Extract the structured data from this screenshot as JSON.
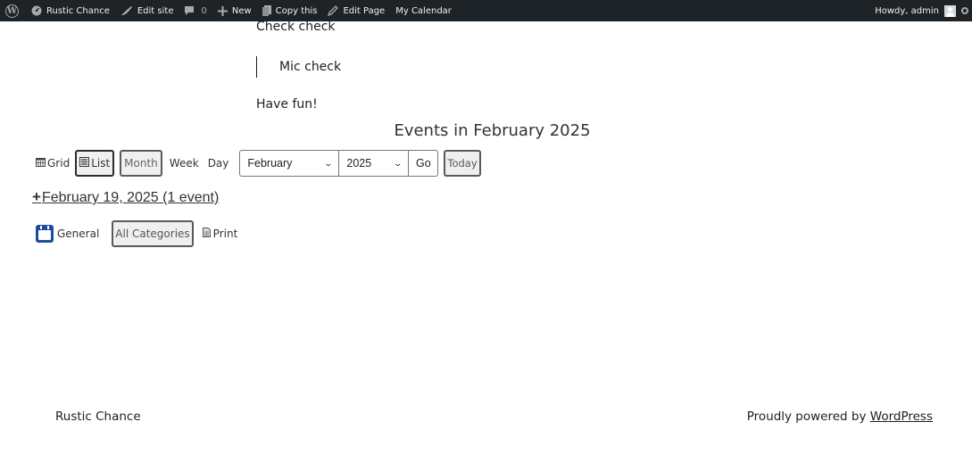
{
  "adminbar": {
    "items": [
      {
        "name": "wp-logo",
        "icon": "wordpress-icon",
        "label": ""
      },
      {
        "name": "site-name",
        "icon": "dashboard-icon",
        "label": "Rustic Chance"
      },
      {
        "name": "edit-site",
        "icon": "brush-icon",
        "label": "Edit site"
      },
      {
        "name": "comments",
        "icon": "comment-icon",
        "label": "0"
      },
      {
        "name": "new",
        "icon": "plus-icon",
        "label": "New"
      },
      {
        "name": "copy-this",
        "icon": "copy-icon",
        "label": "Copy this"
      },
      {
        "name": "edit-page",
        "icon": "pencil-icon",
        "label": "Edit Page"
      },
      {
        "name": "my-calendar",
        "icon": "",
        "label": "My Calendar"
      }
    ],
    "greeting": "Howdy, admin"
  },
  "content": {
    "paragraph1": "Check check",
    "quote": "Mic check",
    "paragraph2": "Have fun!"
  },
  "calendar": {
    "title": "Events in February 2025",
    "views": {
      "grid": "Grid",
      "list": "List",
      "month": "Month",
      "week": "Week",
      "day": "Day"
    },
    "month_select": {
      "selected": "February"
    },
    "year_select": {
      "selected": "2025"
    },
    "go_label": "Go",
    "today_label": "Today",
    "date_entry": {
      "expand_symbol": "+",
      "label": "February 19, 2025 (1 event)"
    },
    "categories": {
      "general": "General",
      "all": "All Categories",
      "print": "Print"
    },
    "colors": {
      "category_general": "#1d4e9a"
    }
  },
  "footer": {
    "site_title": "Rustic Chance",
    "powered_prefix": "Proudly powered by ",
    "powered_link": "WordPress"
  }
}
